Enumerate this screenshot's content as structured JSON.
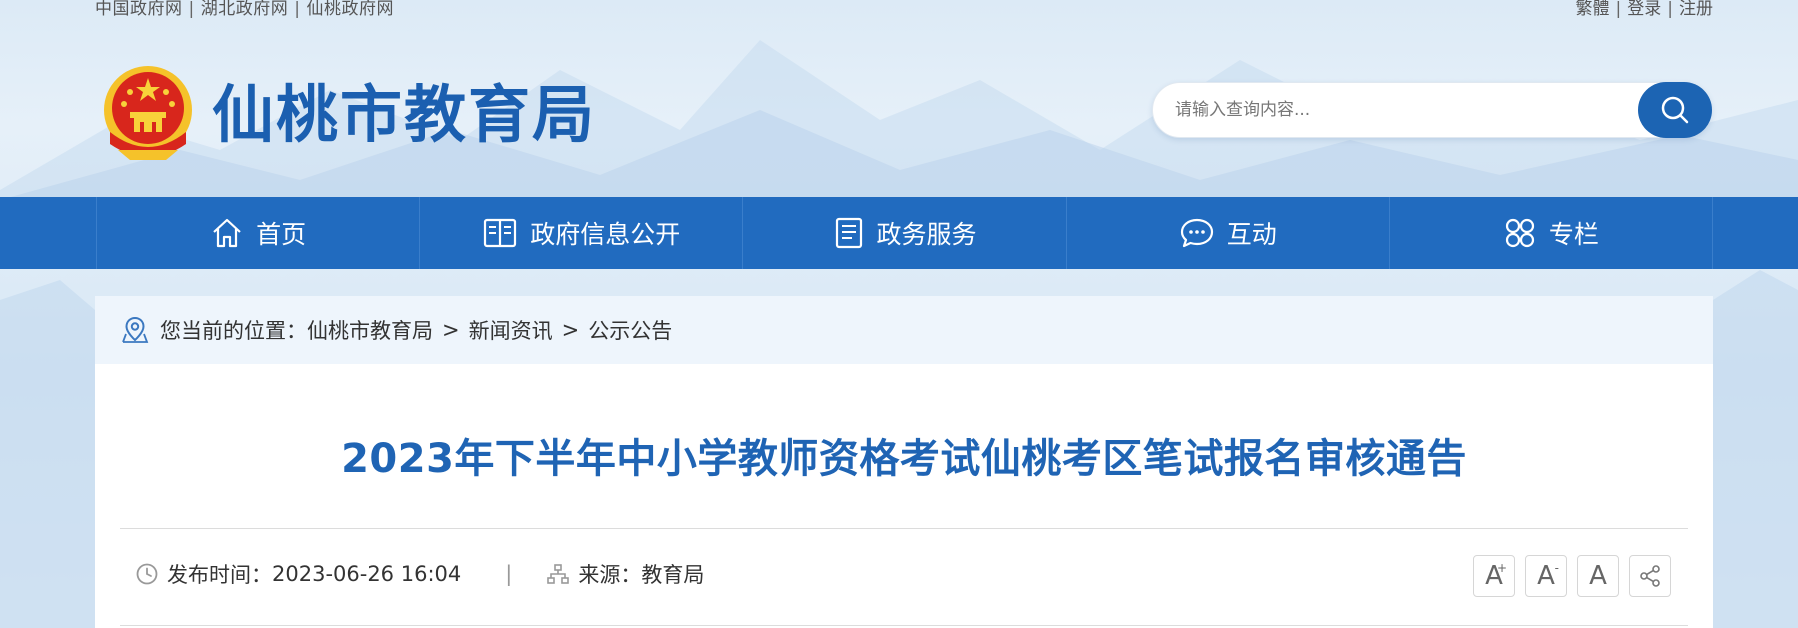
{
  "top_links": {
    "left": [
      "中国政府网",
      "湖北政府网",
      "仙桃政府网"
    ],
    "separator": "|",
    "right": [
      "繁體",
      "登录",
      "注册"
    ]
  },
  "site": {
    "title": "仙桃市教育局"
  },
  "search": {
    "placeholder": "请输入查询内容..."
  },
  "nav": {
    "items": [
      {
        "label": "首页",
        "icon": "home-icon"
      },
      {
        "label": "政府信息公开",
        "icon": "book-icon"
      },
      {
        "label": "政务服务",
        "icon": "document-icon"
      },
      {
        "label": "互动",
        "icon": "chat-icon"
      },
      {
        "label": "专栏",
        "icon": "grid-icon"
      }
    ]
  },
  "breadcrumb": {
    "prefix": "您当前的位置：",
    "items": [
      "仙桃市教育局",
      "新闻资讯",
      "公示公告"
    ],
    "separator": ">"
  },
  "article": {
    "title": "2023年下半年中小学教师资格考试仙桃考区笔试报名审核通告",
    "publish_label": "发布时间：",
    "publish_time": "2023-06-26 16:04",
    "meta_separator": "|",
    "source_label": "来源：",
    "source": "教育局"
  },
  "tools": {
    "increase": "A",
    "increase_sup": "+",
    "decrease": "A",
    "decrease_sup": "-",
    "reset": "A"
  },
  "colors": {
    "brand_blue": "#1b5fb0",
    "nav_blue": "#216bbf",
    "title_blue": "#1f64b4"
  }
}
